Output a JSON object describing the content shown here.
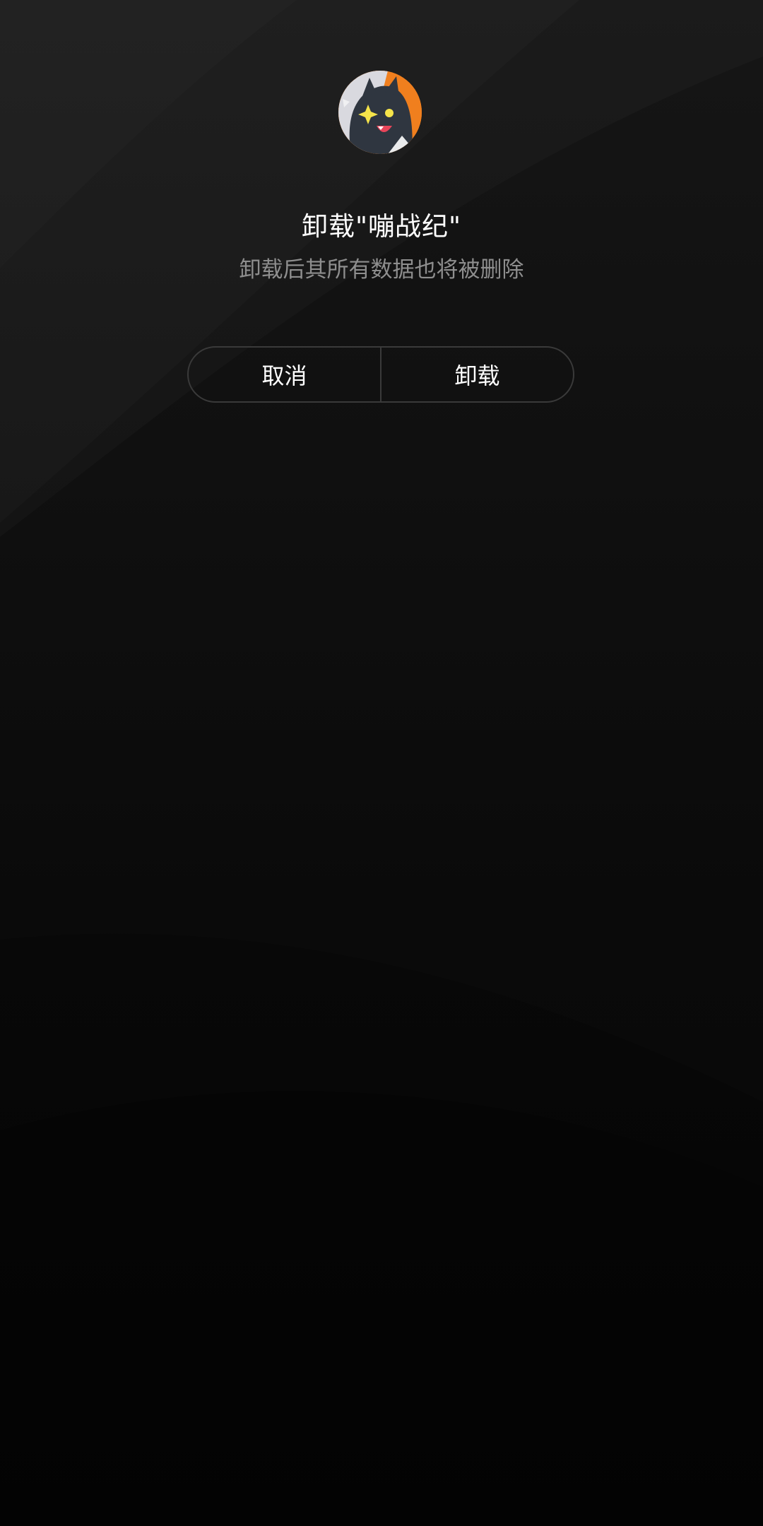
{
  "dialog": {
    "app_icon": "app-avatar-icon",
    "title": "卸载\"嘣战纪\"",
    "subtitle": "卸载后其所有数据也将被删除",
    "cancel_label": "取消",
    "confirm_label": "卸载"
  },
  "colors": {
    "background_top": "#161616",
    "background_bottom": "#060606",
    "title_text": "#ffffff",
    "subtitle_text": "#8e8e8e",
    "button_border": "#3a3a3a",
    "icon_accent": "#f07f1e"
  }
}
